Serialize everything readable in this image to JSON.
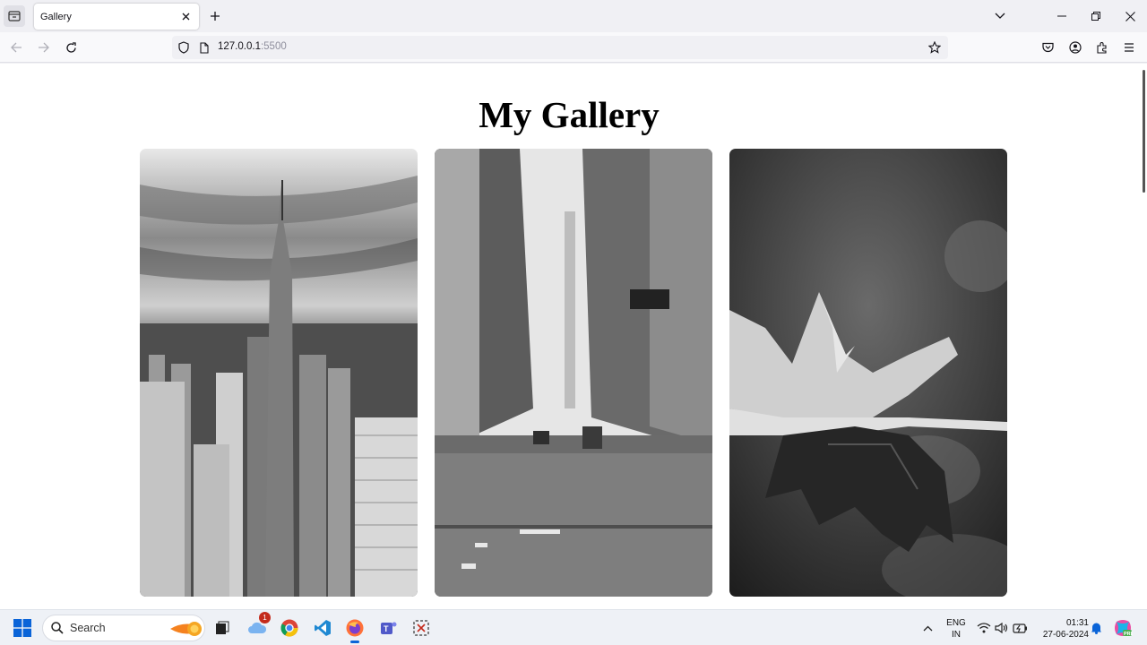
{
  "browser": {
    "tab_title": "Gallery",
    "url_host": "127.0.0.1",
    "url_port": ":5500"
  },
  "page": {
    "title": "My Gallery",
    "images": [
      {
        "subject": "empire-state-building-skyline",
        "alt": "City skyline"
      },
      {
        "subject": "city-street-buildings",
        "alt": "City street"
      },
      {
        "subject": "maple-leaf-closeup",
        "alt": "Leaf"
      }
    ]
  },
  "taskbar": {
    "search_label": "Search",
    "notification_count": "1",
    "lang_line1": "ENG",
    "lang_line2": "IN",
    "time": "01:31",
    "date": "27-06-2024"
  },
  "colors": {
    "chrome_bg": "#f0f0f4",
    "page_bg": "#ffffff",
    "accent_blue": "#0a64d8"
  }
}
